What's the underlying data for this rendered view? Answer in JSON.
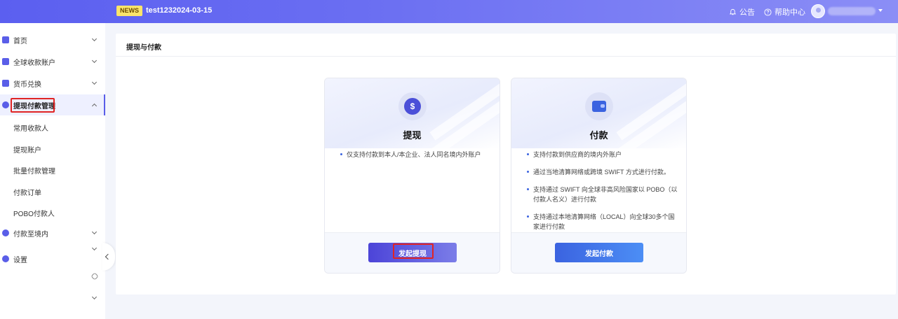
{
  "header": {
    "news_badge": "NEWS",
    "news_text": "test1232024-03-15",
    "announcement_label": "公告",
    "help_label": "帮助中心"
  },
  "sidebar": {
    "items": [
      {
        "label": "首页"
      },
      {
        "label": "全球收款账户"
      },
      {
        "label": "货币兑换"
      },
      {
        "label": "提现付款管理"
      },
      {
        "label": "付款至境内"
      },
      {
        "label": "设置"
      }
    ],
    "sub_items": [
      "常用收款人",
      "提现账户",
      "批量付款管理",
      "付款订单",
      "POBO付款人"
    ]
  },
  "main": {
    "title": "提现与付款",
    "cards": [
      {
        "title": "提现",
        "icon": "money-bag-icon",
        "icon_glyph": "$",
        "bullets": [
          "仅支持付款到本人/本企业、法人同名境内外账户"
        ],
        "button_label": "发起提现"
      },
      {
        "title": "付款",
        "icon": "wallet-icon",
        "bullets": [
          "支持付款到供应商的境内外账户",
          "通过当地清算网络或跨境 SWIFT 方式进行付款。",
          "支持通过 SWIFT 向全球非高风险国家以 POBO（以付款人名义）进行付款",
          "支持通过本地清算网络（LOCAL）向全球30多个国家进行付款"
        ],
        "button_label": "发起付款"
      }
    ]
  },
  "colors": {
    "brand": "#5a5ee8",
    "highlight": "#e02424",
    "pay_button": "#3b63e0"
  }
}
